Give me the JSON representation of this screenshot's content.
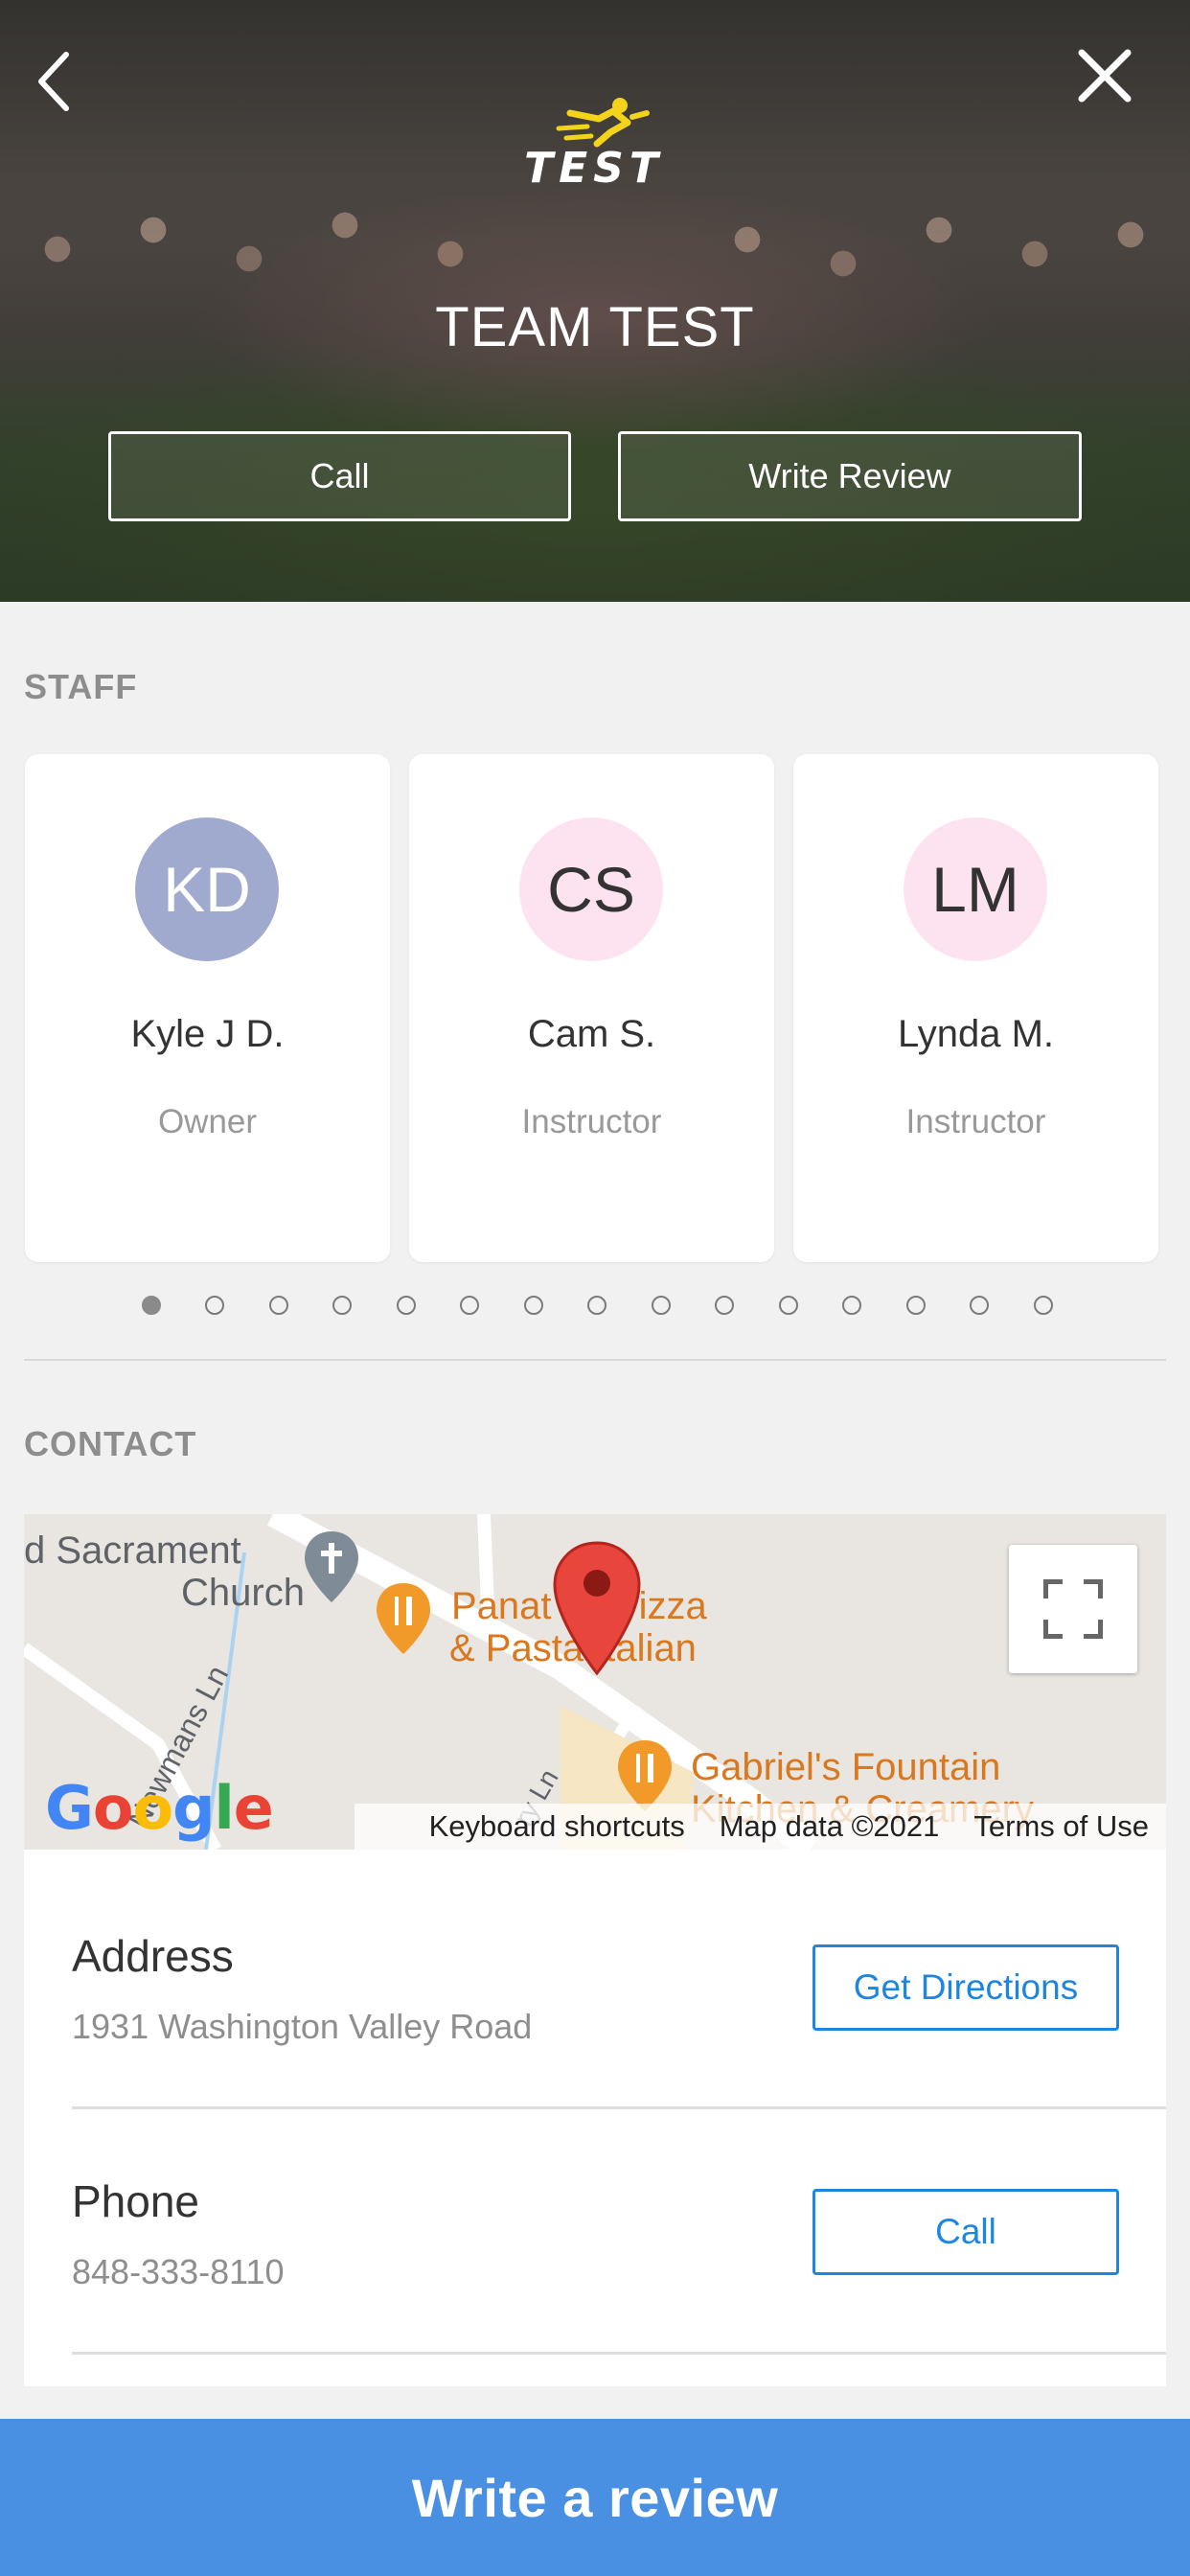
{
  "header": {
    "brand_logo_text": "TEST",
    "title": "TEAM TEST",
    "call_label": "Call",
    "write_review_label": "Write Review",
    "back_icon": "chevron-left-icon",
    "close_icon": "close-icon"
  },
  "staff": {
    "section_title": "STAFF",
    "members": [
      {
        "initials": "KD",
        "name": "Kyle J D.",
        "role": "Owner",
        "avatar_color": "#a0aace"
      },
      {
        "initials": "CS",
        "name": "Cam S.",
        "role": "Instructor",
        "avatar_color": "#fde3ef"
      },
      {
        "initials": "LM",
        "name": "Lynda M.",
        "role": "Instructor",
        "avatar_color": "#fde3ef"
      }
    ],
    "pagination": {
      "total": 15,
      "active": 1
    }
  },
  "contact": {
    "section_title": "CONTACT",
    "map": {
      "labels": {
        "church": "d Sacrament\n   Church",
        "church_line1": "d Sacrament",
        "church_line2": "Church",
        "pizza_line1": "Panat   s Pizza",
        "pizza_line2": "& Pasta Italian",
        "gabriel_line1": "Gabriel's Fountain",
        "gabriel_line2": "Kitchen & Creamery",
        "road_label": "Newmans Ln",
        "road_label2": "ry Ln"
      },
      "google_logo": "Google",
      "keyboard_shortcuts": "Keyboard shortcuts",
      "map_data": "Map data ©2021",
      "terms": "Terms of Use"
    },
    "address_label": "Address",
    "address_value": "1931 Washington Valley Road",
    "directions_label": "Get Directions",
    "phone_label": "Phone",
    "phone_value": "848-333-8110",
    "call_label": "Call"
  },
  "footer": {
    "write_review_label": "Write a review"
  },
  "colors": {
    "accent": "#4a90e2",
    "link_blue": "#1f86df",
    "brand_yellow": "#f4d31b"
  }
}
